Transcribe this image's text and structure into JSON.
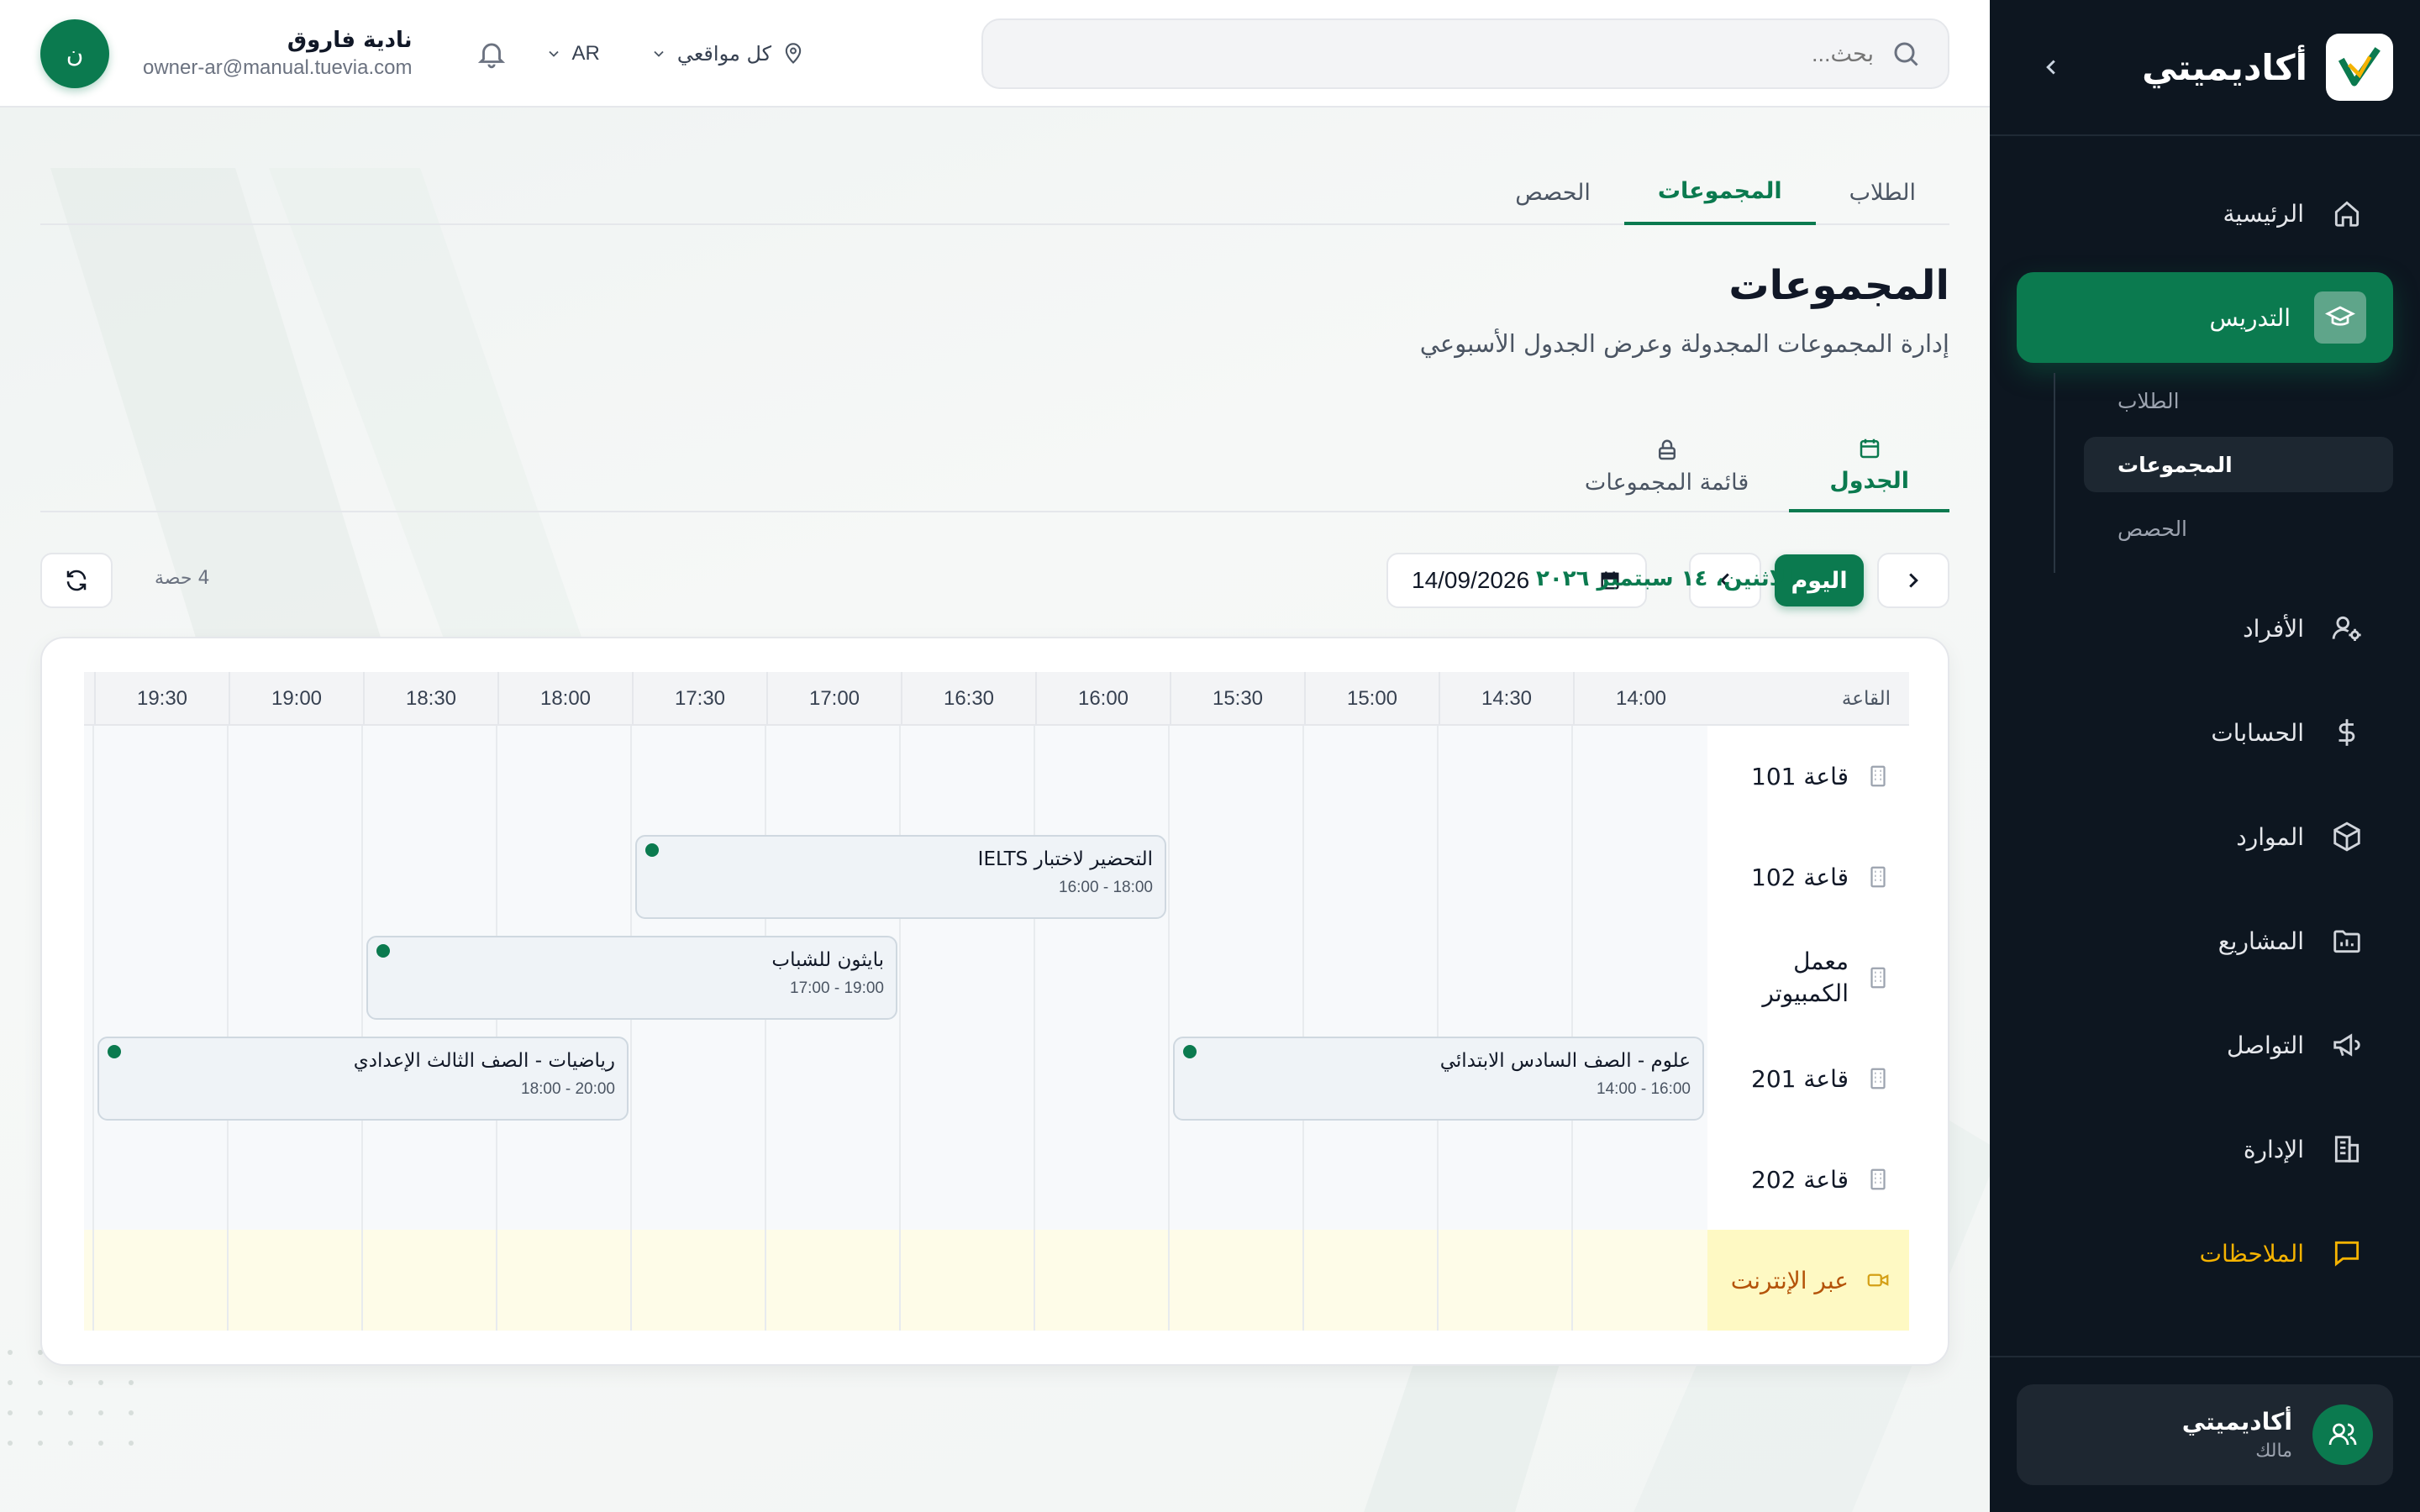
{
  "colors": {
    "primary": "#0b7a4f",
    "sidebar_bg": "#0d1620",
    "notes": "#f5b301"
  },
  "sidebar": {
    "brand": "أكاديميتي",
    "items": [
      {
        "label": "الرئيسية",
        "icon": "home-icon"
      },
      {
        "label": "التدريس",
        "icon": "graduation-cap-icon",
        "active": true
      },
      {
        "label": "الأفراد",
        "icon": "user-gear-icon"
      },
      {
        "label": "الحسابات",
        "icon": "dollar-icon"
      },
      {
        "label": "الموارد",
        "icon": "box-icon"
      },
      {
        "label": "المشاريع",
        "icon": "folder-chart-icon"
      },
      {
        "label": "التواصل",
        "icon": "megaphone-icon"
      },
      {
        "label": "الإدارة",
        "icon": "building-icon"
      },
      {
        "label": "الملاحظات",
        "icon": "message-square-icon"
      }
    ],
    "sub_items": [
      {
        "label": "الطلاب"
      },
      {
        "label": "المجموعات",
        "active": true
      },
      {
        "label": "الحصص"
      }
    ],
    "footer": {
      "name": "أكاديميتي",
      "role": "مالك"
    }
  },
  "topbar": {
    "search_placeholder": "بحث...",
    "location": "كل مواقعي",
    "language": "AR",
    "user_name": "نادية فاروق",
    "user_email": "owner-ar@manual.tuevia.com",
    "avatar_initial": "ن"
  },
  "tabs": [
    "الطلاب",
    "المجموعات",
    "الحصص"
  ],
  "page": {
    "title": "المجموعات",
    "subtitle": "إدارة المجموعات المجدولة وعرض الجدول الأسبوعي"
  },
  "view_tabs": {
    "schedule": "الجدول",
    "list": "قائمة المجموعات"
  },
  "controls": {
    "today": "اليوم",
    "date_value": "14/09/2026",
    "date_label": "الاثنين، ١٤ سبتمبر ٢٠٢٦",
    "count_label": "4 حصة"
  },
  "schedule": {
    "room_header": "القاعة",
    "times": [
      "14:00",
      "14:30",
      "15:00",
      "15:30",
      "16:00",
      "16:30",
      "17:00",
      "17:30",
      "18:00",
      "18:30",
      "19:00",
      "19:30"
    ],
    "rooms": [
      "قاعة 101",
      "قاعة 102",
      "معمل الكمبيوتر",
      "قاعة 201",
      "قاعة 202",
      "عبر الإنترنت"
    ],
    "events": [
      {
        "title": "التحضير لاختبار IELTS",
        "time": "16:00 - 18:00",
        "room": "قاعة 102",
        "start": "16:00",
        "end": "18:00"
      },
      {
        "title": "بايثون للشباب",
        "time": "17:00 - 19:00",
        "room": "معمل الكمبيوتر",
        "start": "17:00",
        "end": "19:00"
      },
      {
        "title": "علوم - الصف السادس الابتدائي",
        "time": "14:00 - 16:00",
        "room": "قاعة 201",
        "start": "14:00",
        "end": "16:00"
      },
      {
        "title": "رياضيات - الصف الثالث الإعدادي",
        "time": "18:00 - 20:00",
        "room": "قاعة 201",
        "start": "18:00",
        "end": "20:00"
      }
    ]
  }
}
